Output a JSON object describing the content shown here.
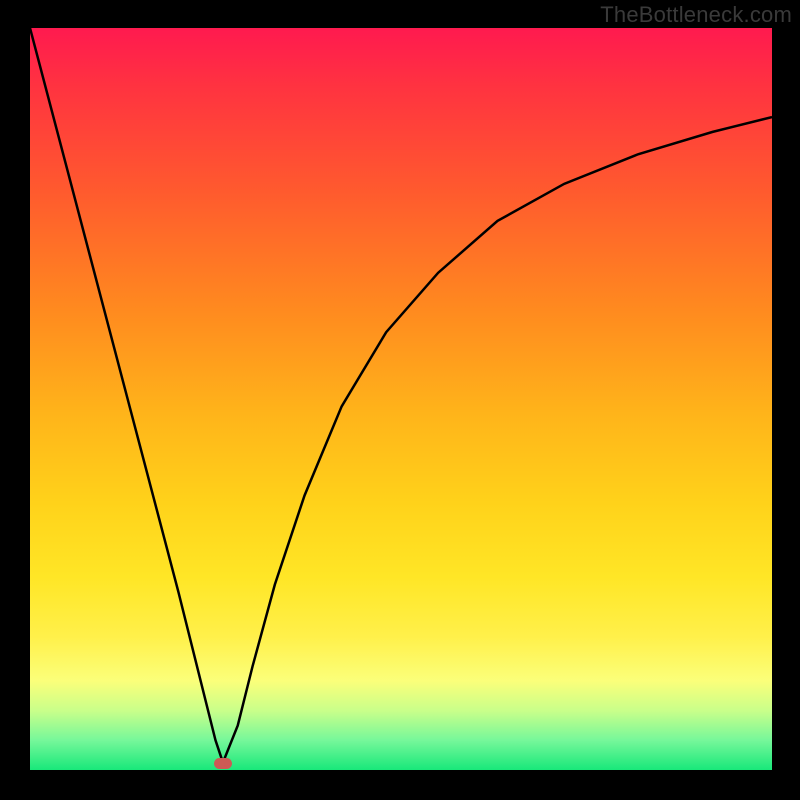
{
  "watermark": "TheBottleneck.com",
  "chart_data": {
    "type": "line",
    "title": "",
    "xlabel": "",
    "ylabel": "",
    "xlim": [
      0,
      100
    ],
    "ylim": [
      0,
      100
    ],
    "grid": false,
    "legend": false,
    "background": "rainbow-gradient (red top → green bottom)",
    "series": [
      {
        "name": "left-branch",
        "x": [
          0,
          5,
          10,
          15,
          20,
          23,
          25,
          26
        ],
        "y": [
          100,
          81,
          62,
          43,
          24,
          12,
          4,
          1
        ]
      },
      {
        "name": "right-branch",
        "x": [
          26,
          28,
          30,
          33,
          37,
          42,
          48,
          55,
          63,
          72,
          82,
          92,
          100
        ],
        "y": [
          1,
          6,
          14,
          25,
          37,
          49,
          59,
          67,
          74,
          79,
          83,
          86,
          88
        ]
      }
    ],
    "annotations": [
      {
        "name": "minimum-marker",
        "type": "pill",
        "x": 26,
        "y": 0.8,
        "color": "#cc5a55"
      }
    ]
  },
  "colors": {
    "frame": "#000000",
    "curve": "#000000",
    "marker": "#cc5a55",
    "watermark": "#3a3a3a"
  }
}
